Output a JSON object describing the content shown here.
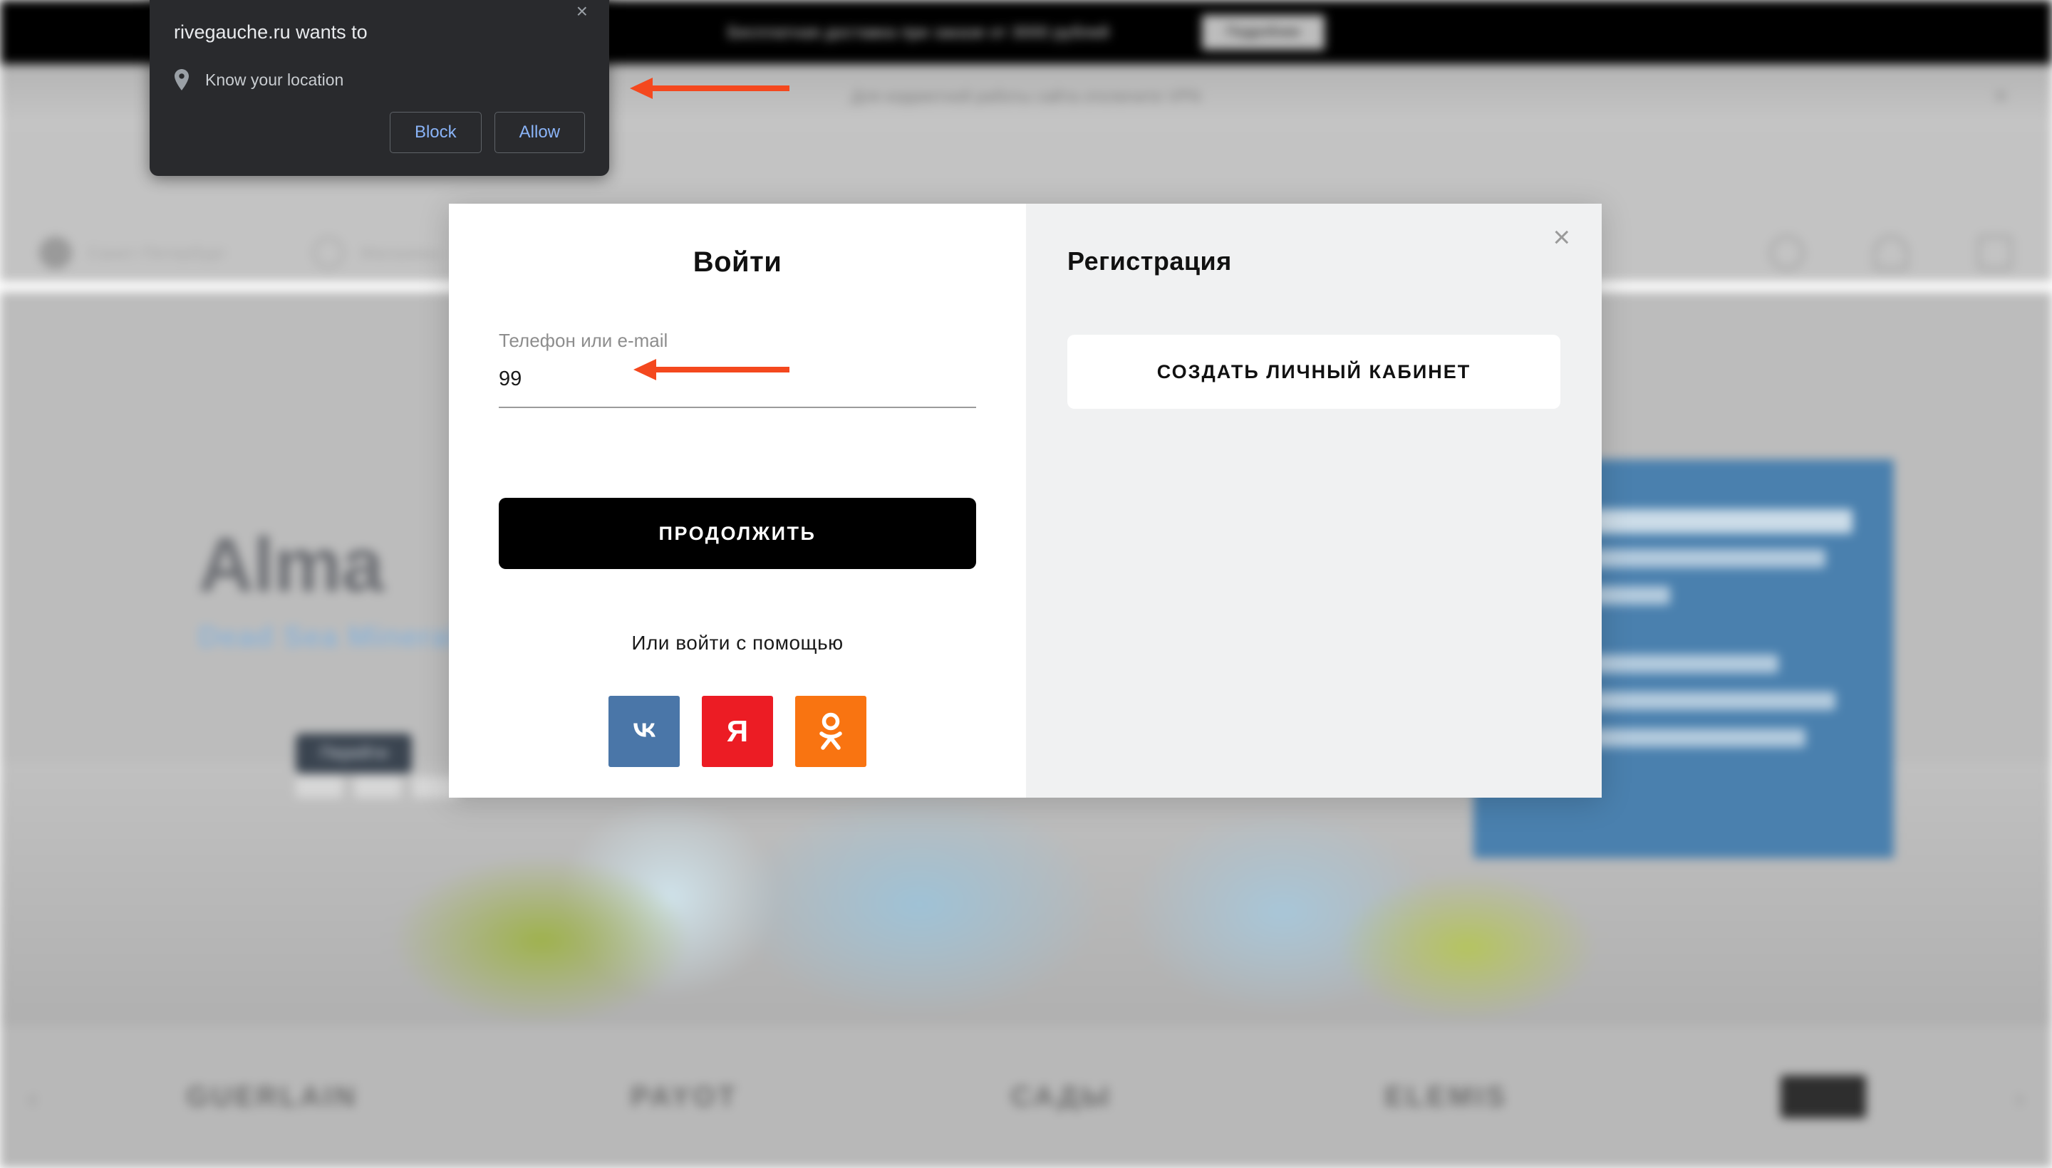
{
  "permission_dialog": {
    "title": "rivegauche.ru wants to",
    "permission_label": "Know your location",
    "icon": "location-pin-icon",
    "close_icon": "×",
    "block_label": "Block",
    "allow_label": "Allow",
    "bg_color": "#292a2d",
    "link_color": "#8ab4f8"
  },
  "browser_page": {
    "promo_bar": {
      "text": "Бесплатная доставка при заказе от 3000 рублей",
      "button_label": "Подробнее"
    },
    "notice_bar": {
      "text": "Для корректной работы сайта отключите VPN",
      "close_icon": "×"
    },
    "header": {
      "location_label": "Санкт-Петербург",
      "shops_label": "Магазины",
      "icons": [
        "search-icon",
        "account-icon",
        "cart-icon"
      ]
    },
    "hero": {
      "title": "Alma",
      "subtitle": "Dead Sea Minerals",
      "pill_label": "Перейти"
    },
    "blue_panel": {
      "lines": 7
    },
    "brands": [
      "GUERLAIN",
      "PAYOT",
      "САДЫ",
      "ELEMIS"
    ],
    "carousel": {
      "prev_icon": "‹",
      "next_icon": "›"
    }
  },
  "login_modal": {
    "close_icon": "×",
    "left": {
      "title": "Войти",
      "field_label": "Телефон или e-mail",
      "field_value": "99",
      "submit_label": "ПРОДОЛЖИТЬ",
      "or_label": "Или войти с помощью",
      "socials": [
        {
          "name": "vk-icon",
          "glyph": "В",
          "color": "#4a76a8"
        },
        {
          "name": "yandex-icon",
          "glyph": "Я",
          "color": "#ec1c24"
        },
        {
          "name": "odnoklassniki-icon",
          "glyph": "ОК",
          "color": "#f97411"
        }
      ]
    },
    "right": {
      "title": "Регистрация",
      "button_label": "СОЗДАТЬ ЛИЧНЫЙ КАБИНЕТ"
    }
  },
  "annotations": {
    "color": "#f4481e",
    "arrows": [
      {
        "name": "arrow-to-notice-bar",
        "points_to": "notice-bar"
      },
      {
        "name": "arrow-to-login-input",
        "points_to": "login-phone-input"
      }
    ]
  }
}
